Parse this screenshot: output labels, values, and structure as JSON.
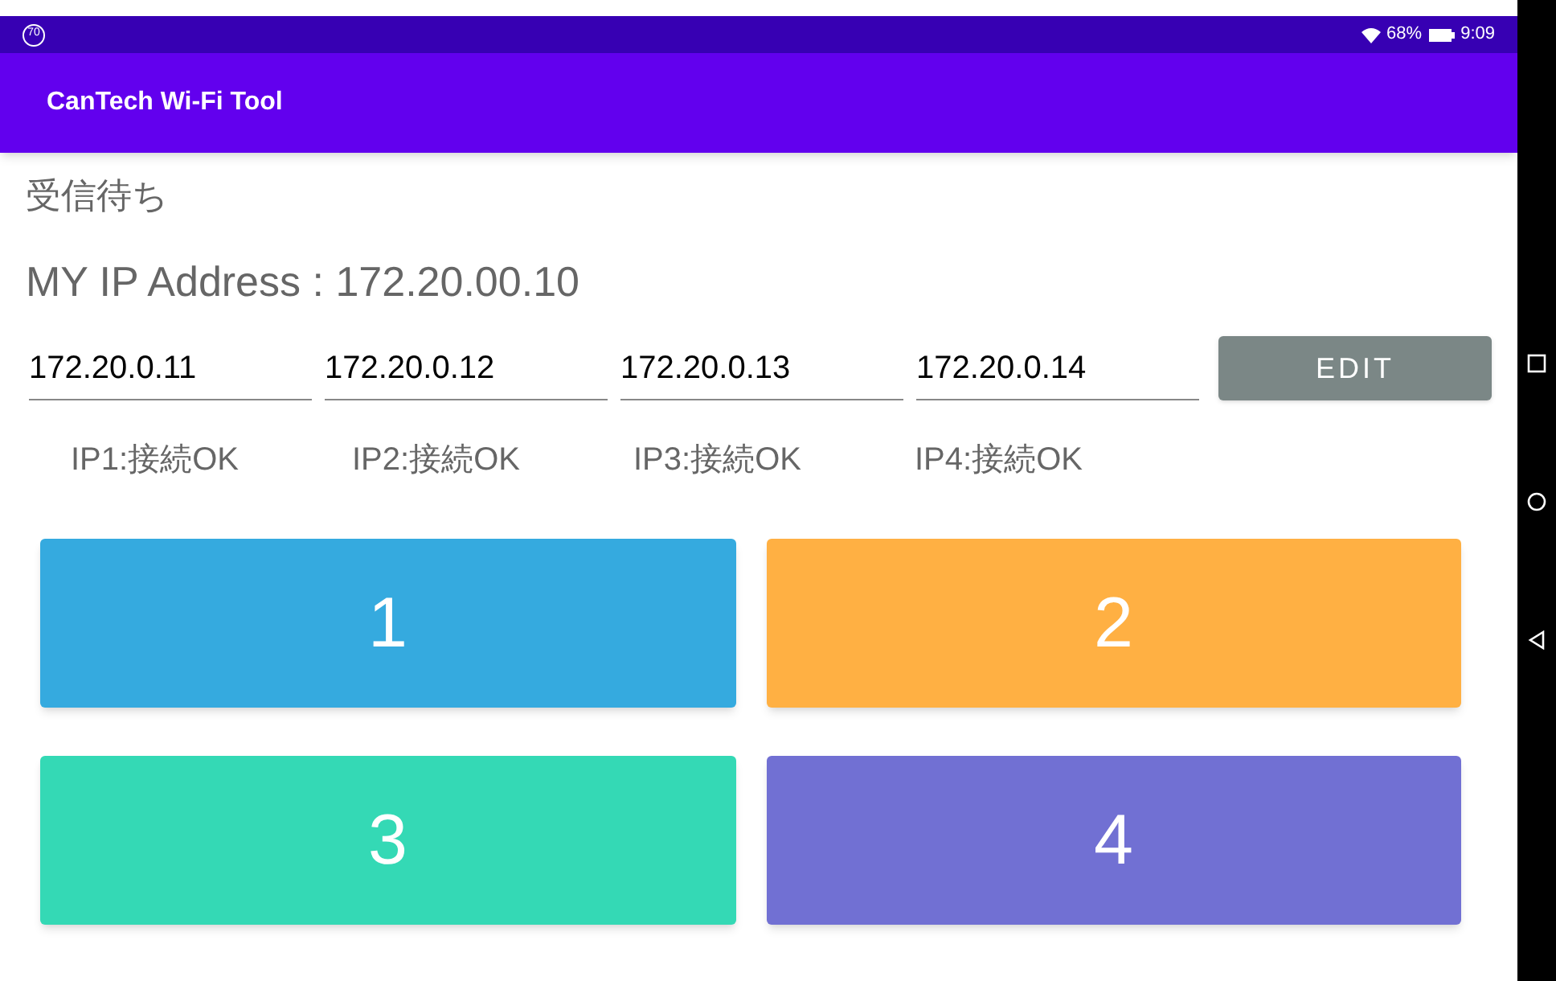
{
  "status_bar": {
    "badge": "70",
    "battery": "68%",
    "time": "9:09"
  },
  "app_bar": {
    "title": "CanTech Wi-Fi Tool"
  },
  "status_text": "受信待ち",
  "my_ip": "MY IP Address : 172.20.00.10",
  "ip_fields": [
    {
      "value": "172.20.0.11"
    },
    {
      "value": "172.20.0.12"
    },
    {
      "value": "172.20.0.13"
    },
    {
      "value": "172.20.0.14"
    }
  ],
  "edit_button": "EDIT",
  "connection_labels": [
    "IP1:接続OK",
    "IP2:接続OK",
    "IP3:接続OK",
    "IP4:接続OK"
  ],
  "buttons": [
    {
      "label": "1",
      "color": "#35aadf"
    },
    {
      "label": "2",
      "color": "#ffb043"
    },
    {
      "label": "3",
      "color": "#34d9b5"
    },
    {
      "label": "4",
      "color": "#7170d3"
    }
  ]
}
